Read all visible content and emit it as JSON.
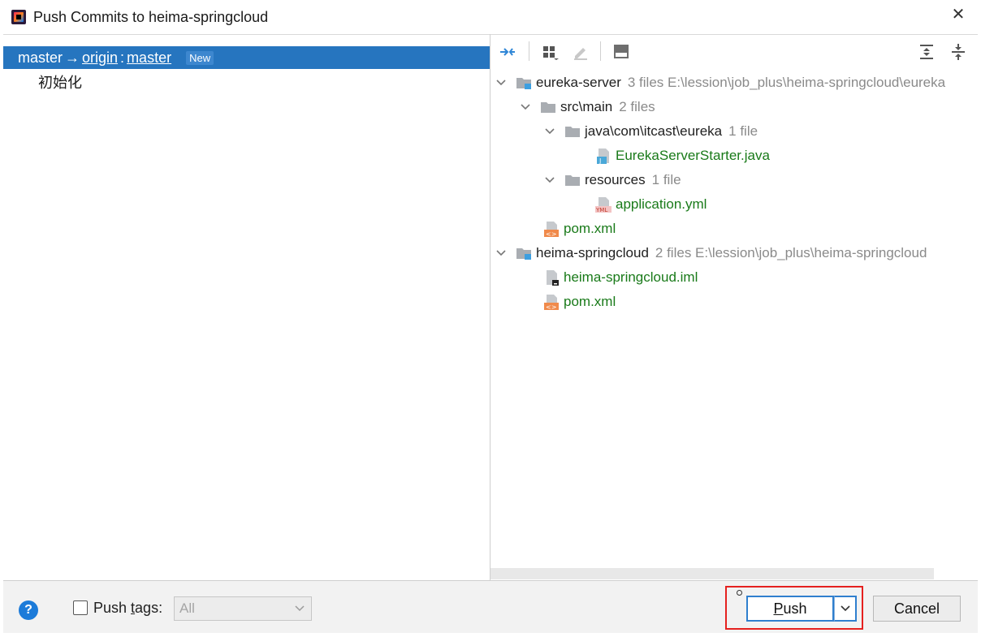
{
  "window": {
    "title": "Push Commits to heima-springcloud",
    "close_glyph": "✕"
  },
  "left": {
    "branch": {
      "local": "master",
      "arrow": "→",
      "remote": "origin",
      "separator": ":",
      "remote_branch": "master",
      "badge": "New"
    },
    "commits": [
      "初始化"
    ]
  },
  "toolbar": {
    "icons": [
      "expand-collapse-arrows-icon",
      "group-by-icon",
      "edit-icon",
      "diff-panel-icon",
      "expand-all-icon",
      "collapse-all-icon"
    ]
  },
  "tree": {
    "nodes": [
      {
        "name": "eureka-server",
        "meta": "3 files  E:\\lession\\job_plus\\heima-springcloud\\eureka"
      },
      {
        "name": "src\\main",
        "meta": "2 files"
      },
      {
        "name": "java\\com\\itcast\\eureka",
        "meta": "1 file"
      },
      {
        "name": "EurekaServerStarter.java",
        "meta": ""
      },
      {
        "name": "resources",
        "meta": "1 file"
      },
      {
        "name": "application.yml",
        "meta": ""
      },
      {
        "name": "pom.xml",
        "meta": ""
      },
      {
        "name": "heima-springcloud",
        "meta": "2 files  E:\\lession\\job_plus\\heima-springcloud"
      },
      {
        "name": "heima-springcloud.iml",
        "meta": ""
      },
      {
        "name": "pom.xml",
        "meta": ""
      }
    ]
  },
  "bottom": {
    "help": "?",
    "push_tags_pre": "Push ",
    "push_tags_u": "t",
    "push_tags_post": "ags:",
    "select_value": "All",
    "push_u": "P",
    "push_rest": "ush",
    "cancel": "Cancel"
  },
  "colors": {
    "selection": "#2675bf",
    "new_file_green": "#197a19",
    "highlight": "#e5211f",
    "focus_blue": "#2f7fce"
  }
}
